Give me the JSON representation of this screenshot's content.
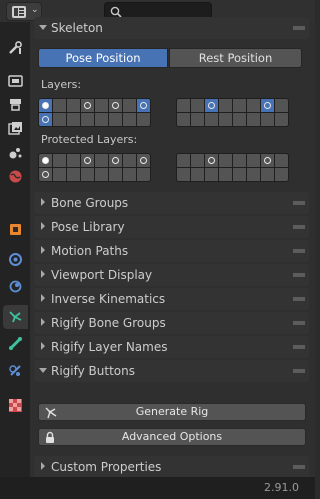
{
  "skeleton": {
    "title": "Skeleton",
    "pose_position": "Pose Position",
    "rest_position": "Rest Position",
    "layers_label": "Layers:",
    "protected_label": "Protected Layers:"
  },
  "panels": [
    "Bone Groups",
    "Pose Library",
    "Motion Paths",
    "Viewport Display",
    "Inverse Kinematics",
    "Rigify Bone Groups",
    "Rigify Layer Names",
    "Rigify Buttons"
  ],
  "buttons": {
    "generate": "Generate Rig",
    "advanced": "Advanced Options"
  },
  "custom_properties": "Custom Properties",
  "version": "2.91.0",
  "colors": {
    "accent": "#4772b3",
    "background": "#2f2f2f"
  }
}
